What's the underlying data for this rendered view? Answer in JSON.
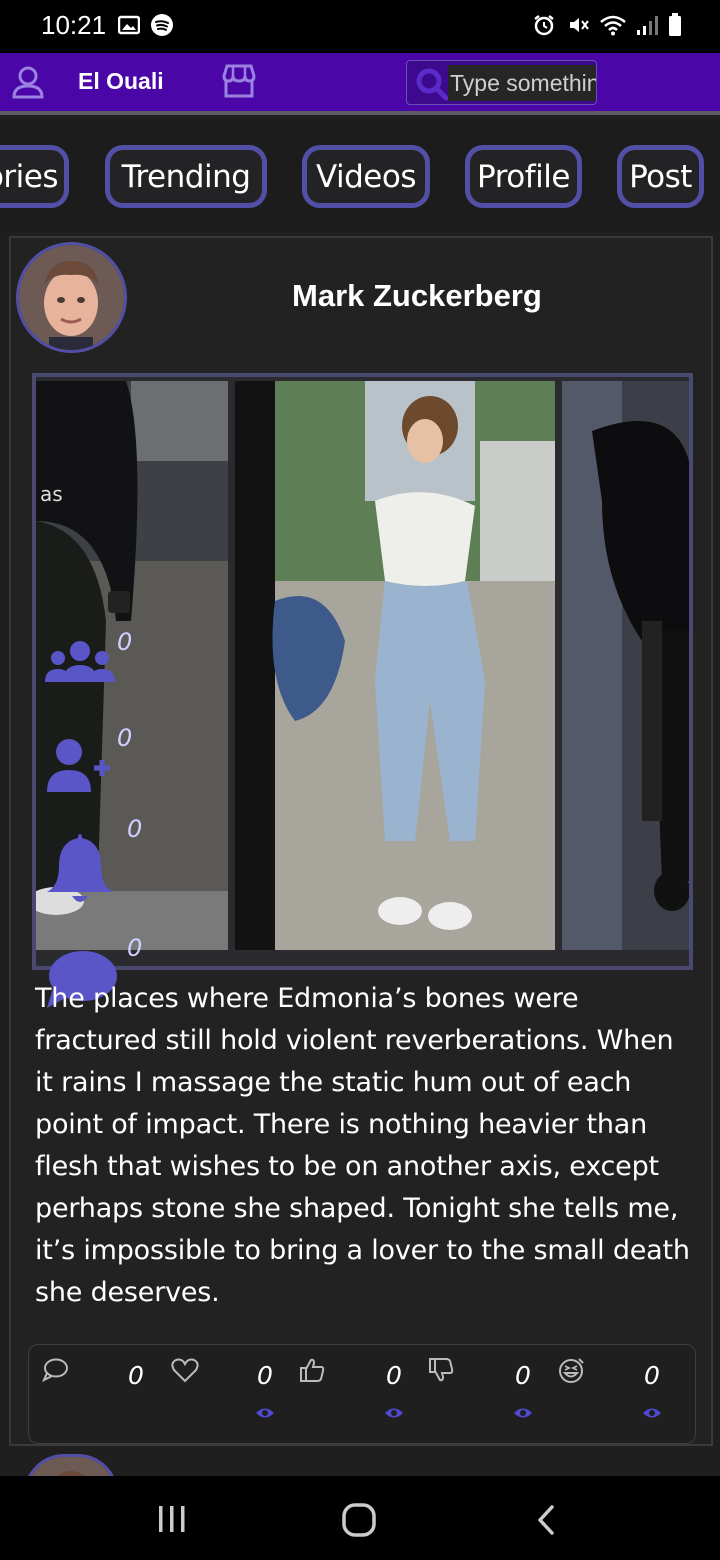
{
  "status_bar": {
    "time": "10:21"
  },
  "app_bar": {
    "username": "El Ouali",
    "search_placeholder": "Type somethin"
  },
  "tabs": [
    {
      "label": "ories"
    },
    {
      "label": "Trending"
    },
    {
      "label": "Videos"
    },
    {
      "label": "Profile"
    },
    {
      "label": "Post"
    }
  ],
  "post": {
    "author": "Mark Zuckerberg",
    "text": "The places where Edmonia’s bones were fractured still hold violent reverberations. When it rains I massage the static hum out of each point of impact. There is nothing heavier than flesh that wishes to be on another axis, except perhaps stone she shaped. Tonight she tells me, it’s impossible to bring a lover to the small death she deserves.",
    "side_stats": [
      {
        "icon": "group-icon",
        "count": "0"
      },
      {
        "icon": "add-user-icon",
        "count": "0"
      },
      {
        "icon": "bell-icon",
        "count": "0"
      },
      {
        "icon": "chat-bubble-icon",
        "count": "0"
      }
    ],
    "actions": [
      {
        "icon": "comment-icon",
        "count": "0"
      },
      {
        "icon": "heart-icon",
        "count": "0"
      },
      {
        "icon": "thumbs-up-icon",
        "count": "0"
      },
      {
        "icon": "thumbs-down-icon",
        "count": "0"
      },
      {
        "icon": "laugh-icon",
        "count": "0"
      }
    ]
  },
  "colors": {
    "app_bar": "#4a06a6",
    "accent": "#5150a6",
    "background": "#1f1f20"
  }
}
